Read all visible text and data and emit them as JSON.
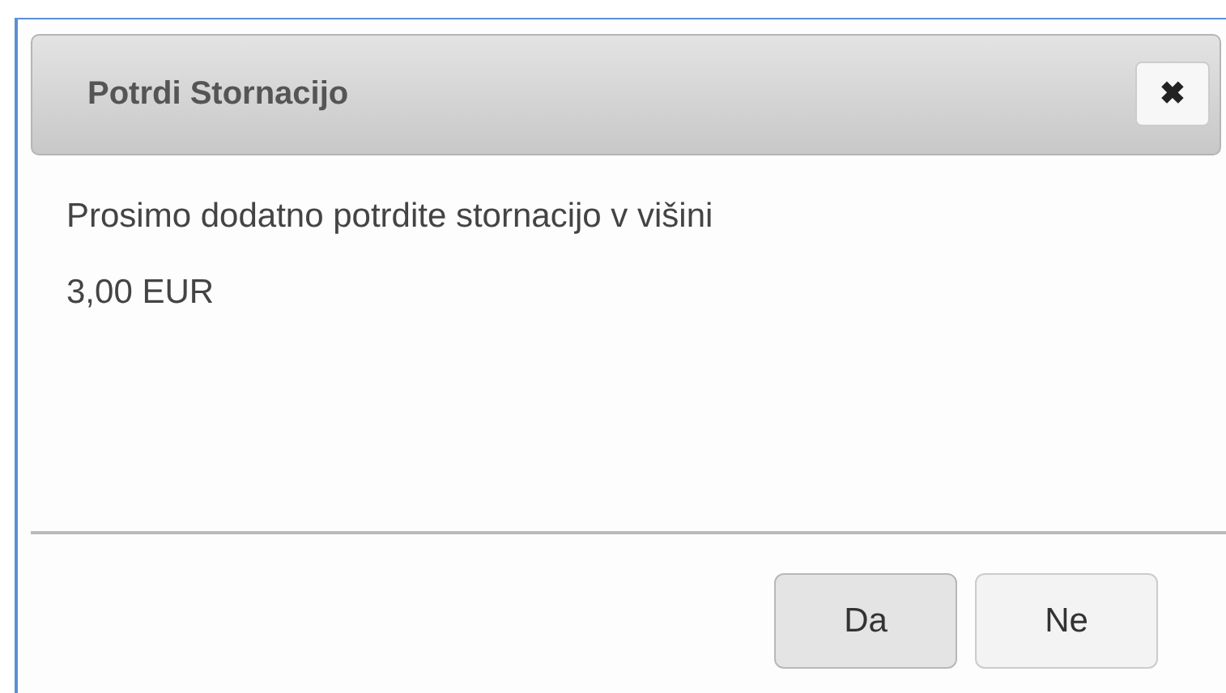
{
  "dialog": {
    "title": "Potrdi Stornacijo",
    "close_icon": "✖",
    "message": "Prosimo dodatno potrdite stornacijo v višini 3,00 EUR",
    "buttons": [
      {
        "label": "Da",
        "selected": true
      },
      {
        "label": "Ne",
        "selected": false
      }
    ]
  }
}
